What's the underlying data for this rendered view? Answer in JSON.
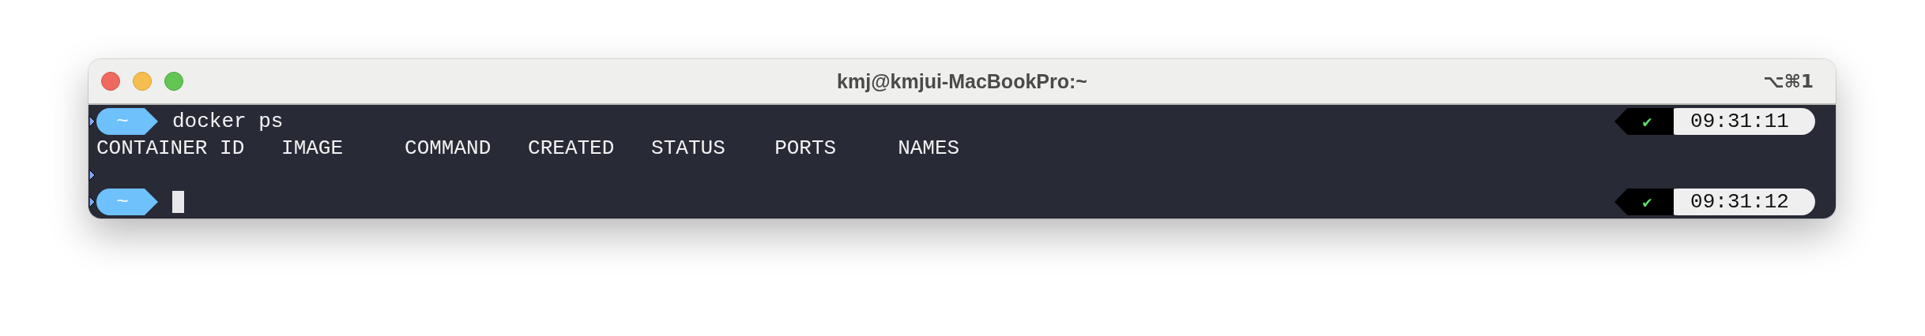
{
  "window": {
    "title": "kmj@kmjui-MacBookPro:~",
    "shortcut": "⌥⌘1"
  },
  "lines": [
    {
      "kind": "prompt",
      "dir": "~",
      "command": "docker ps",
      "status": "✔",
      "time": "09:31:11"
    },
    {
      "kind": "output",
      "text": "CONTAINER ID   IMAGE     COMMAND   CREATED   STATUS    PORTS     NAMES"
    },
    {
      "kind": "marker"
    },
    {
      "kind": "prompt",
      "dir": "~",
      "status": "✔",
      "time": "09:31:12",
      "cursor": true
    }
  ]
}
